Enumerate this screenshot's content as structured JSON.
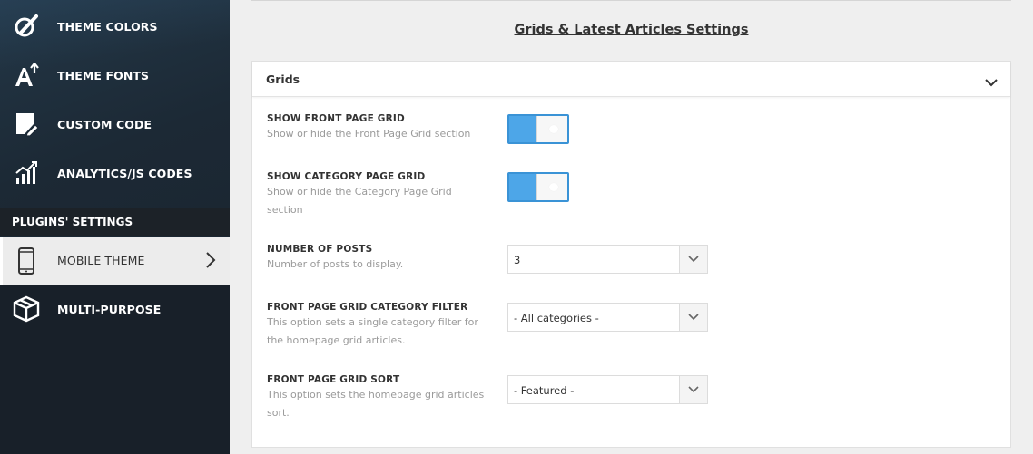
{
  "sidebar": {
    "items": [
      {
        "label": "THEME COLORS",
        "icon": "paintbrush-icon"
      },
      {
        "label": "THEME FONTS",
        "icon": "font-size-icon"
      },
      {
        "label": "CUSTOM CODE",
        "icon": "code-edit-icon"
      },
      {
        "label": "ANALYTICS/JS CODES",
        "icon": "analytics-bars-icon"
      }
    ],
    "section_label": "PLUGINS' SETTINGS",
    "plugins": [
      {
        "label": "MOBILE THEME",
        "icon": "mobile-phone-icon",
        "active": true
      },
      {
        "label": "MULTI-PURPOSE",
        "icon": "cube-icon"
      }
    ]
  },
  "main": {
    "title": "Grids & Latest Articles Settings",
    "panel": {
      "title": "Grids",
      "settings": [
        {
          "title": "SHOW FRONT PAGE GRID",
          "description": "Show or hide the Front Page Grid section",
          "control": "toggle",
          "value": "on"
        },
        {
          "title": "SHOW CATEGORY PAGE GRID",
          "description": "Show or hide the Category Page Grid section",
          "control": "toggle",
          "value": "on"
        },
        {
          "title": "NUMBER OF POSTS",
          "description": "Number of posts to display.",
          "control": "select",
          "value": "3"
        },
        {
          "title": "FRONT PAGE GRID CATEGORY FILTER",
          "description": "This option sets a single category filter for the homepage grid articles.",
          "control": "select",
          "value": "- All categories -"
        },
        {
          "title": "FRONT PAGE GRID SORT",
          "description": "This option sets the homepage grid articles sort.",
          "control": "select",
          "value": "- Featured -"
        }
      ]
    }
  },
  "colors": {
    "toggle_on": "#4da6e8",
    "sidebar_bg": "#1c2935",
    "active_item_bg": "#ececec"
  }
}
